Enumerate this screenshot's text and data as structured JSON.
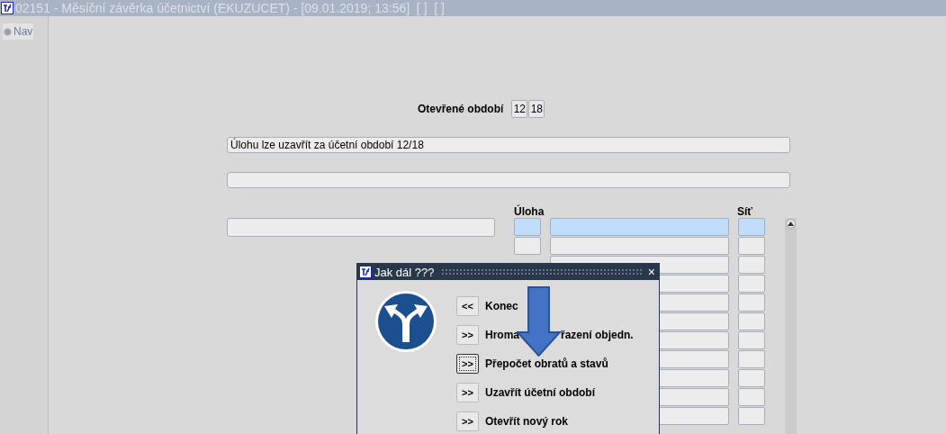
{
  "window": {
    "title": "02151 - Měsíční závěrka účetnictví (EKUZUCET) - [09.01.2019; 13:56]  [ ]  [ ]"
  },
  "sidebar": {
    "tabs": [
      {
        "label": "Nav",
        "selected": true
      }
    ]
  },
  "open_period": {
    "label": "Otevřené období",
    "month": "12",
    "year": "18"
  },
  "message_field": {
    "value": "Úlohu lze uzavřít za účetní období 12/18"
  },
  "grid": {
    "columns": [
      "Úloha",
      "Síť"
    ],
    "rows": [
      {
        "selected": true
      },
      {
        "selected": false
      },
      {
        "selected": false
      },
      {
        "selected": false
      },
      {
        "selected": false
      },
      {
        "selected": false
      },
      {
        "selected": false
      },
      {
        "selected": false
      },
      {
        "selected": false
      },
      {
        "selected": false
      },
      {
        "selected": false
      }
    ]
  },
  "dialog": {
    "title": "Jak dál ???",
    "close": "×",
    "actions": [
      {
        "button": "<<",
        "label_parts": [
          "Konec"
        ],
        "focused": false
      },
      {
        "button": ">>",
        "label_parts": [
          "Hroma",
          "řazení objedn."
        ],
        "focused": false
      },
      {
        "button": ">>",
        "label_parts": [
          "Přepočet obratů a stavů"
        ],
        "focused": true
      },
      {
        "button": ">>",
        "label_parts": [
          "Uzavřít účetní období"
        ],
        "focused": false
      },
      {
        "button": ">>",
        "label_parts": [
          "Otevřít nový rok"
        ],
        "focused": false
      }
    ]
  }
}
